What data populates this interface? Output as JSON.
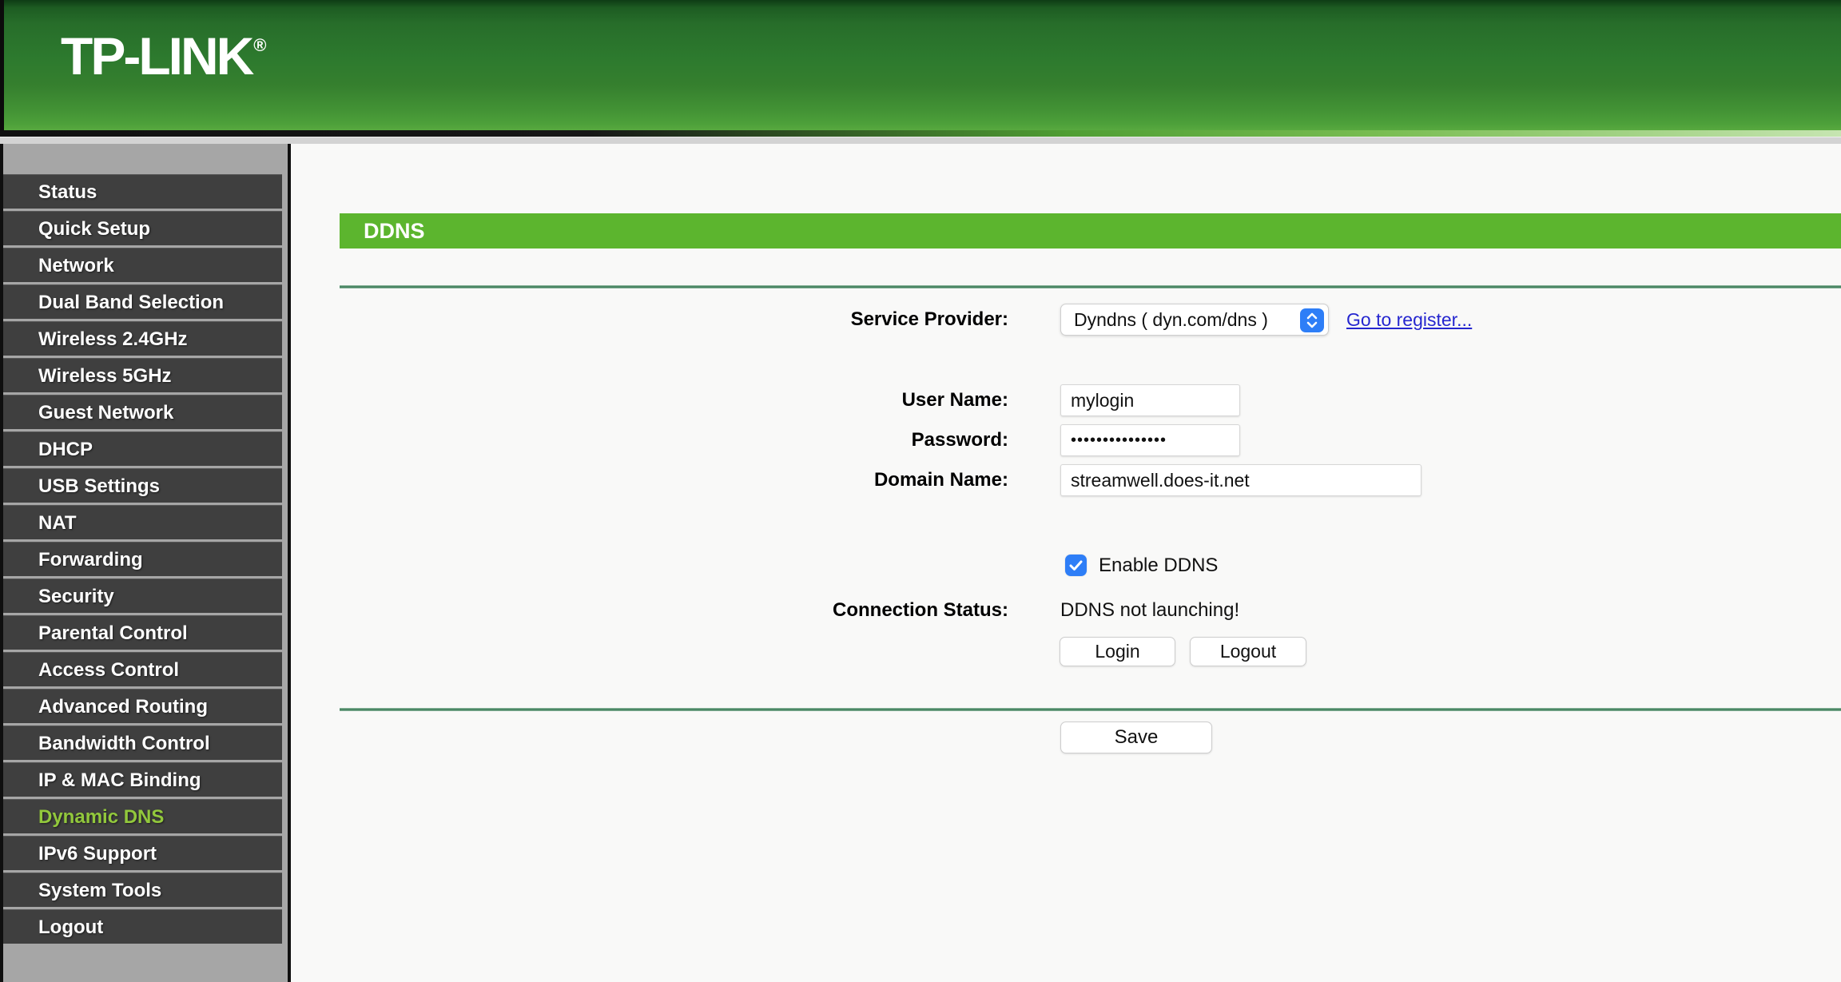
{
  "brand": {
    "name": "TP-LINK",
    "registered_mark": "®"
  },
  "sidebar": {
    "items": [
      {
        "label": "Status"
      },
      {
        "label": "Quick Setup"
      },
      {
        "label": "Network"
      },
      {
        "label": "Dual Band Selection"
      },
      {
        "label": "Wireless 2.4GHz"
      },
      {
        "label": "Wireless 5GHz"
      },
      {
        "label": "Guest Network"
      },
      {
        "label": "DHCP"
      },
      {
        "label": "USB Settings"
      },
      {
        "label": "NAT"
      },
      {
        "label": "Forwarding"
      },
      {
        "label": "Security"
      },
      {
        "label": "Parental Control"
      },
      {
        "label": "Access Control"
      },
      {
        "label": "Advanced Routing"
      },
      {
        "label": "Bandwidth Control"
      },
      {
        "label": "IP & MAC Binding"
      },
      {
        "label": "Dynamic DNS",
        "active": true
      },
      {
        "label": "IPv6 Support"
      },
      {
        "label": "System Tools"
      },
      {
        "label": "Logout"
      }
    ]
  },
  "page": {
    "title": "DDNS",
    "service_provider": {
      "label": "Service Provider:",
      "selected_option": "Dyndns ( dyn.com/dns )",
      "register_link": "Go to register..."
    },
    "user_name": {
      "label": "User Name:",
      "value": "mylogin"
    },
    "password": {
      "label": "Password:",
      "value": "•••••••••••••••"
    },
    "domain_name": {
      "label": "Domain Name:",
      "value": "streamwell.does-it.net"
    },
    "enable_ddns": {
      "label": "Enable DDNS",
      "checked": true
    },
    "connection_status": {
      "label": "Connection Status:",
      "value": "DDNS not launching!"
    },
    "buttons": {
      "login": "Login",
      "logout": "Logout",
      "save": "Save"
    }
  },
  "colors": {
    "accent_green": "#5cb52e",
    "active_item": "#92c83c",
    "link_blue": "#2526cf",
    "checkbox_blue": "#2e7ef7"
  }
}
